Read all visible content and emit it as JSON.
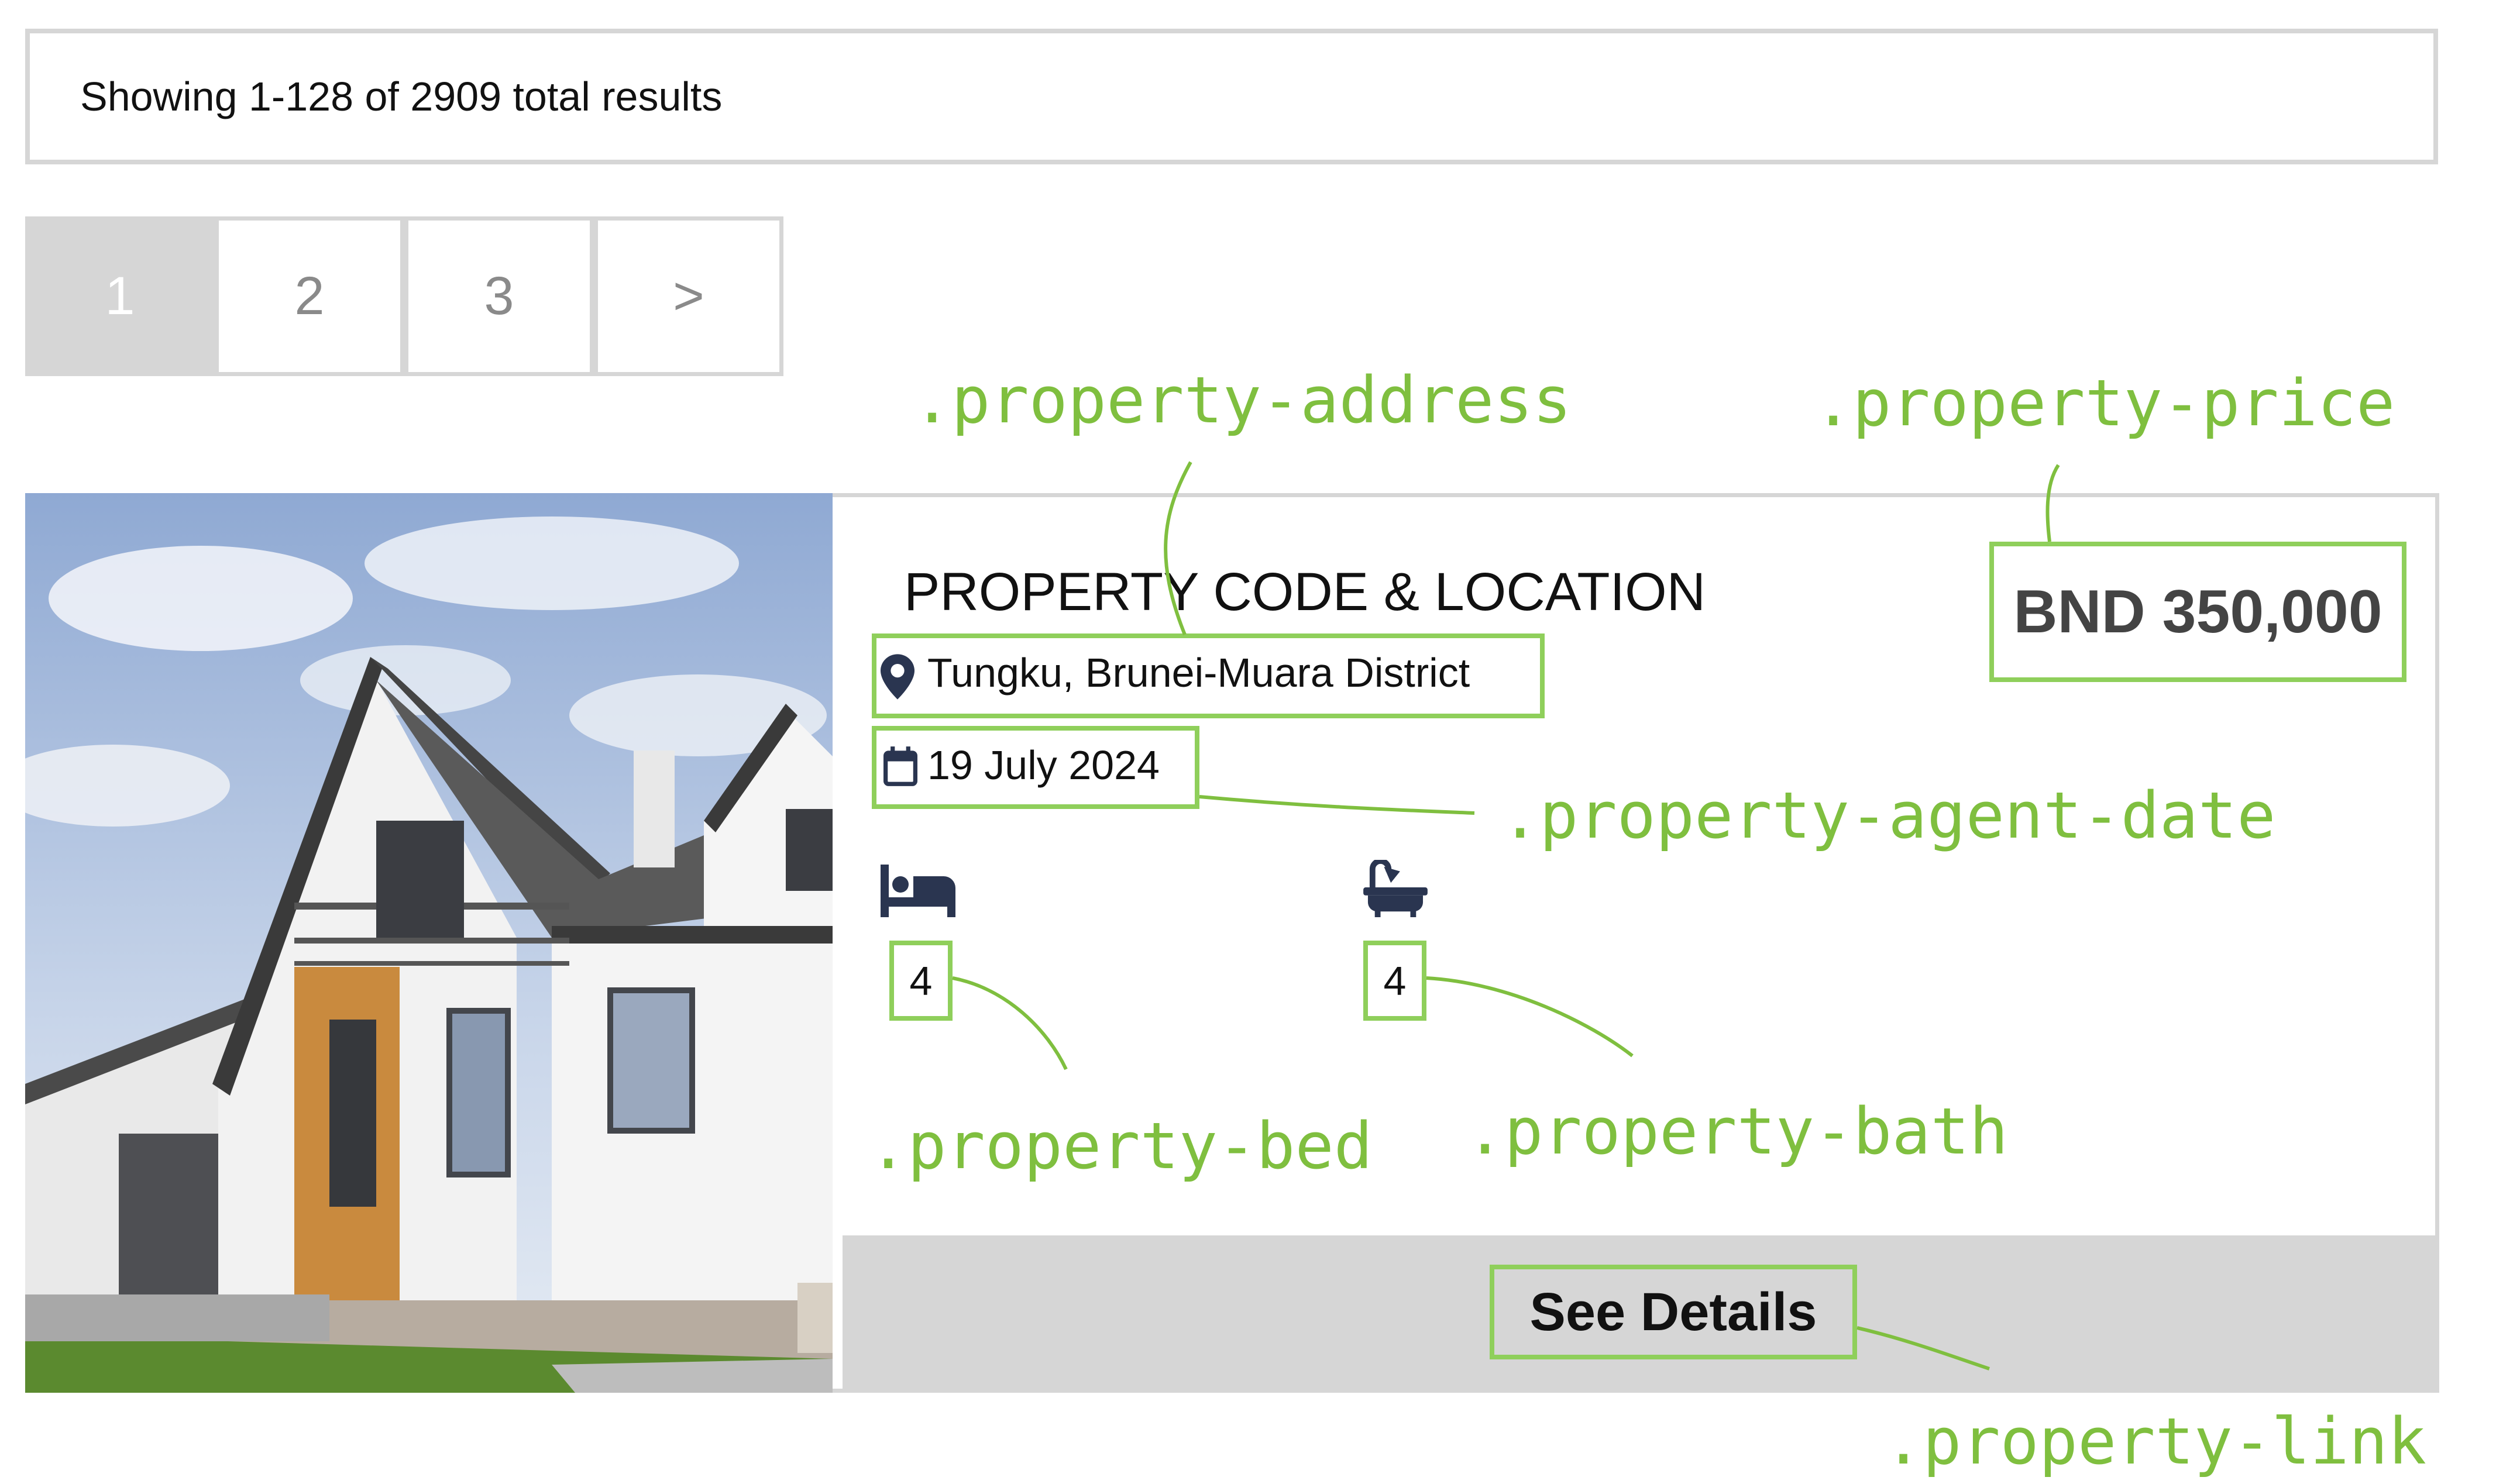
{
  "results": {
    "text": "Showing 1-128 of 2909 total results"
  },
  "pagination": {
    "pages": [
      "1",
      "2",
      "3",
      ">"
    ],
    "active": "1"
  },
  "property": {
    "title": "PROPERTY CODE & LOCATION",
    "address": "Tungku, Brunei-Muara District",
    "date": "19 July 2024",
    "price": "BND 350,000",
    "beds": "4",
    "baths": "4",
    "link_label": "See Details"
  },
  "labels": {
    "address": ".property-address",
    "price": ".property-price",
    "agent_date": ".property-agent-date",
    "bed": ".property-bed",
    "bath": ".property-bath",
    "link": ".property-link"
  },
  "icons": {
    "location": "map-pin-icon",
    "date": "calendar-icon",
    "bed": "bed-icon",
    "bath": "bathtub-icon"
  },
  "colors": {
    "annotation": "#8fcf5b",
    "label": "#7fbf3f",
    "border": "#d6d6d6",
    "details_bar": "#d6d6d6",
    "icon": "#2a3550"
  }
}
